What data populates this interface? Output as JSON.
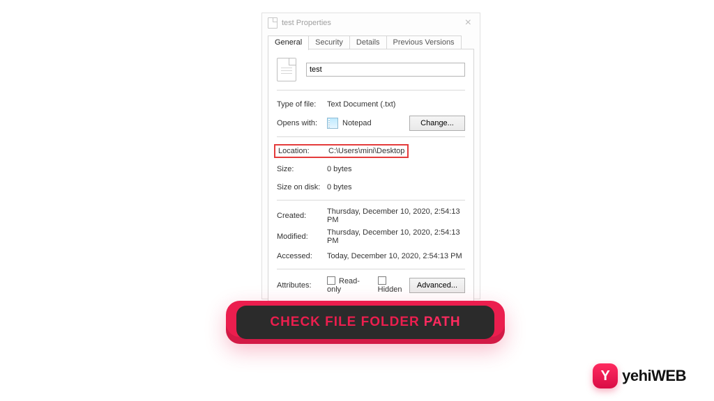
{
  "window": {
    "title": "test Properties"
  },
  "tabs": [
    "General",
    "Security",
    "Details",
    "Previous Versions"
  ],
  "active_tab": 0,
  "file": {
    "name": "test",
    "type_label": "Type of file:",
    "type_value": "Text Document (.txt)",
    "opens_label": "Opens with:",
    "opens_value": "Notepad",
    "change_btn": "Change...",
    "location_label": "Location:",
    "location_value": "C:\\Users\\mini\\Desktop",
    "size_label": "Size:",
    "size_value": "0 bytes",
    "diskSize_label": "Size on disk:",
    "diskSize_value": "0 bytes",
    "created_label": "Created:",
    "created_value": "Thursday, December 10, 2020, 2:54:13 PM",
    "modified_label": "Modified:",
    "modified_value": "Thursday, December 10, 2020, 2:54:13 PM",
    "accessed_label": "Accessed:",
    "accessed_value": "Today, December 10, 2020, 2:54:13 PM",
    "attributes_label": "Attributes:",
    "readonly_label": "Read-only",
    "hidden_label": "Hidden",
    "advanced_btn": "Advanced..."
  },
  "banner": {
    "text_a": "CHECK FILE FOLDER",
    "text_b": "PATH"
  },
  "logo": {
    "badge": "Y",
    "brand_a": "yehi",
    "brand_b": "WEB"
  }
}
